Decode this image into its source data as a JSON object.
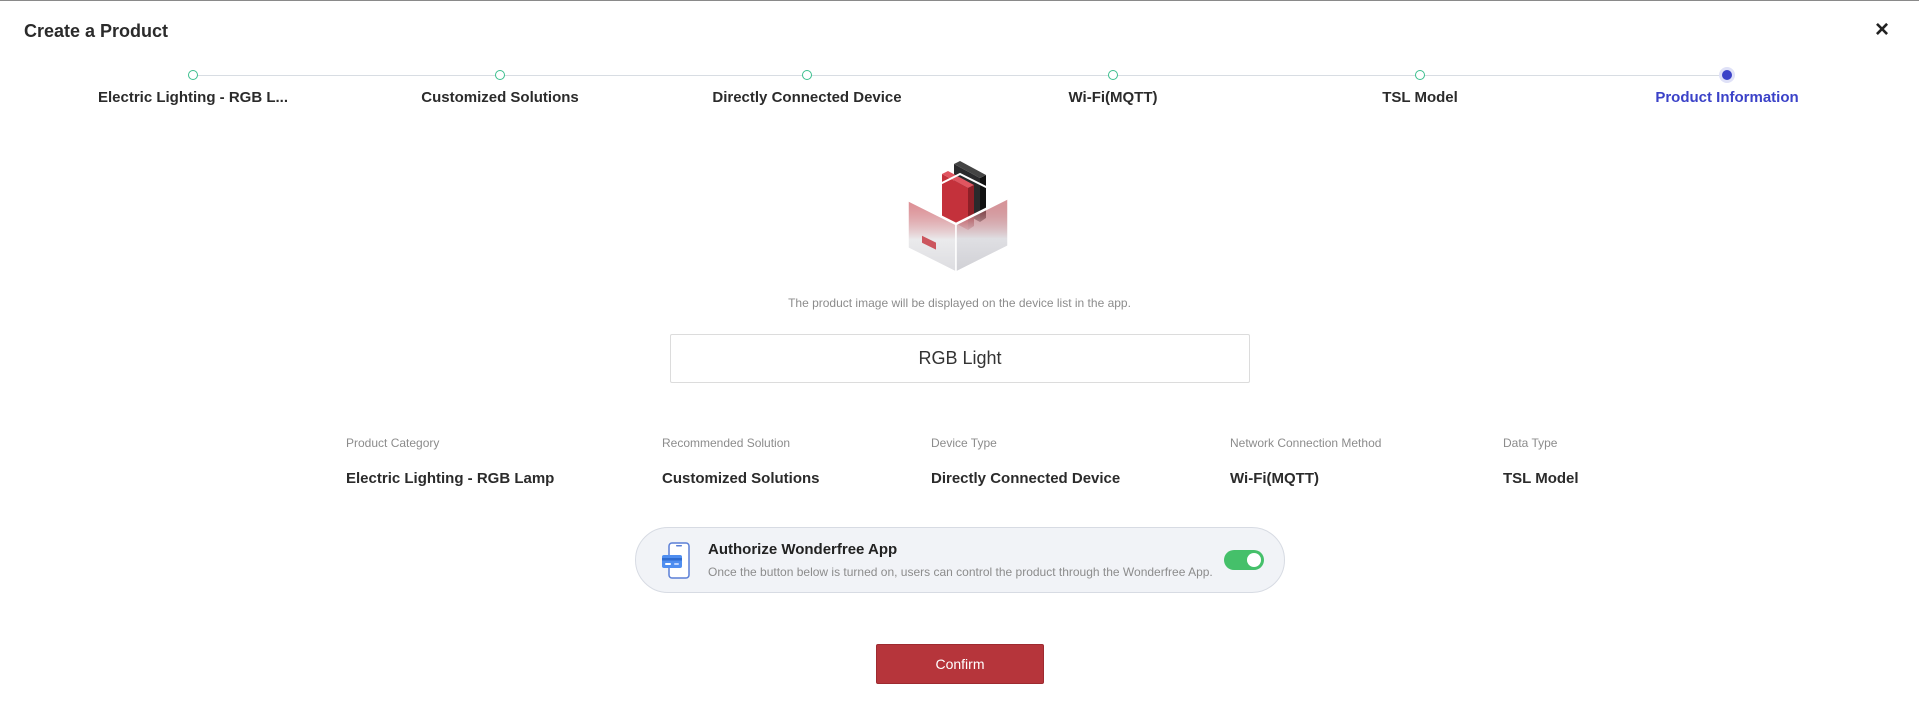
{
  "dialog": {
    "title": "Create a Product",
    "close_symbol": "×"
  },
  "steps": [
    {
      "label": "Electric Lighting - RGB L...",
      "state": "done"
    },
    {
      "label": "Customized Solutions",
      "state": "done"
    },
    {
      "label": "Directly Connected Device",
      "state": "done"
    },
    {
      "label": "Wi-Fi(MQTT)",
      "state": "done"
    },
    {
      "label": "TSL Model",
      "state": "done"
    },
    {
      "label": "Product Information",
      "state": "active"
    }
  ],
  "product": {
    "image_icon": "product-box-image",
    "image_hint": "The product image will be displayed on the device list in the app.",
    "name_value": "RGB Light"
  },
  "info": [
    {
      "label": "Product Category",
      "value": "Electric Lighting - RGB Lamp"
    },
    {
      "label": "Recommended Solution",
      "value": "Customized Solutions"
    },
    {
      "label": "Device Type",
      "value": "Directly Connected Device"
    },
    {
      "label": "Network Connection Method",
      "value": "Wi-Fi(MQTT)"
    },
    {
      "label": "Data Type",
      "value": "TSL Model"
    }
  ],
  "authorize": {
    "icon": "phone-icon",
    "title": "Authorize Wonderfree App",
    "description": "Once the button below is turned on, users can control the product through the Wonderfree App.",
    "enabled": true
  },
  "confirm_label": "Confirm",
  "colors": {
    "accent_blue": "#3b42c8",
    "step_done_green": "#3bbf8e",
    "toggle_on": "#45c06a",
    "confirm_red": "#b6353b"
  }
}
